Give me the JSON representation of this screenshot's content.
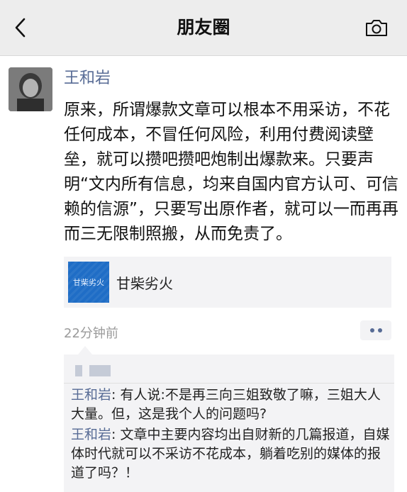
{
  "header": {
    "title": "朋友圈",
    "back_icon": "chevron-left-icon",
    "camera_icon": "camera-icon"
  },
  "post": {
    "author": "王和岩",
    "text": "原来，所谓爆款文章可以根本不用采访，不花任何成本，不冒任何风险，利用付费阅读壁垒，就可以攒吧攒吧炮制出爆款来。只要声明“文内所有信息，均来自国内官方认可、可信赖的信源”，只要写出原作者，就可以一而再再而三无限制照搬，从而免责了。",
    "shared_link": {
      "thumb_text": "甘柴劣火",
      "title": "甘柴劣火",
      "thumb_color": "#1f6dc6"
    },
    "time": "22分钟前"
  },
  "comments": [
    {
      "name": "王和岩",
      "separator": ": ",
      "text": "有人说:不是再三向三姐致敬了嘛，三姐大人大量。但，这是我个人的问题吗?"
    },
    {
      "name": "王和岩",
      "separator": ": ",
      "text": "文章中主要内容均出自财新的几篇报道，自媒体时代就可以不采访不花成本，躺着吃别的媒体的报道了吗？！"
    }
  ],
  "colors": {
    "name_blue": "#576b95",
    "header_bg": "#ededed",
    "card_bg": "#f3f3f5"
  }
}
